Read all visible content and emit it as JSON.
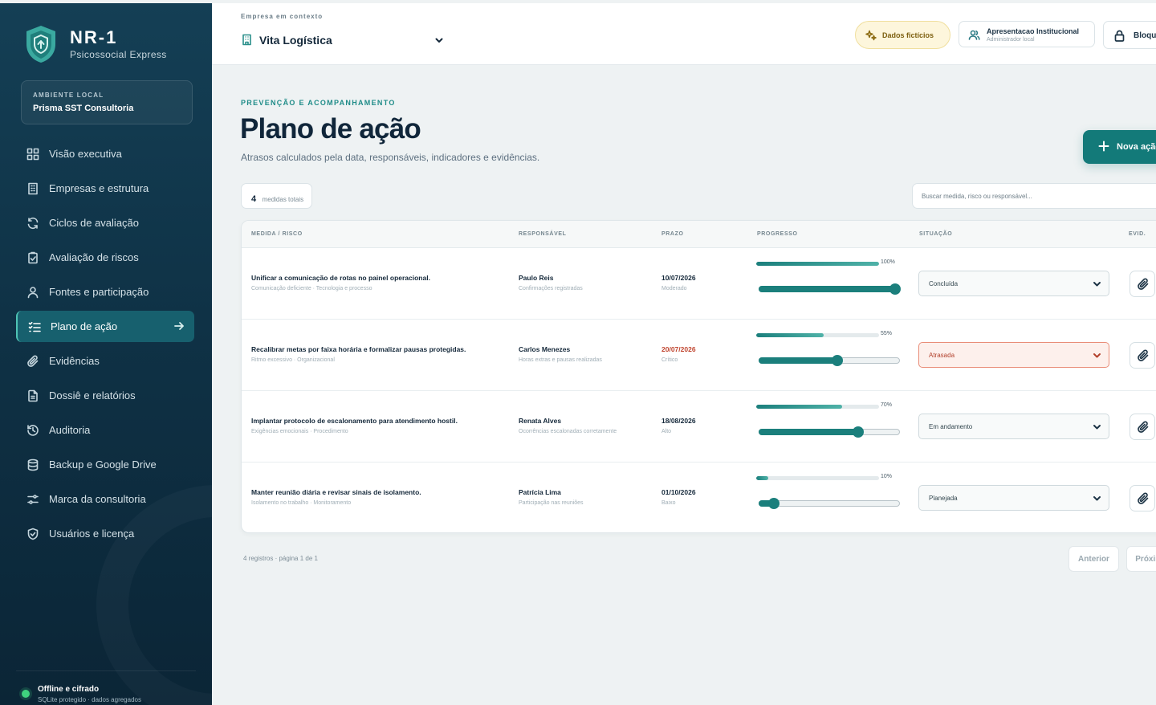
{
  "sidebar": {
    "brand_title": "NR-1",
    "brand_subtitle": "Psicossocial Express",
    "env_label": "AMBIENTE LOCAL",
    "env_name": "Prisma SST Consultoria",
    "items": [
      {
        "label": "Visão executiva",
        "icon": "grid-icon"
      },
      {
        "label": "Empresas e estrutura",
        "icon": "building-icon"
      },
      {
        "label": "Ciclos de avaliação",
        "icon": "refresh-icon"
      },
      {
        "label": "Avaliação de riscos",
        "icon": "clipboard-check-icon"
      },
      {
        "label": "Fontes e participação",
        "icon": "users-icon"
      },
      {
        "label": "Plano de ação",
        "icon": "list-checks-icon",
        "active": true
      },
      {
        "label": "Evidências",
        "icon": "paperclip-icon"
      },
      {
        "label": "Dossiê e relatórios",
        "icon": "file-icon"
      },
      {
        "label": "Auditoria",
        "icon": "history-icon"
      },
      {
        "label": "Backup e Google Drive",
        "icon": "database-icon"
      },
      {
        "label": "Marca da consultoria",
        "icon": "palette-icon"
      },
      {
        "label": "Usuários e licença",
        "icon": "shield-check-icon"
      }
    ],
    "status_title": "Offline e cifrado",
    "status_subtitle": "SQLite protegido · dados agregados",
    "status_color": "#3fd37e"
  },
  "topbar": {
    "context_label": "Empresa em contexto",
    "context_company": "Vita Logística",
    "demo_label": "Dados fictícios",
    "user_name": "Apresentacao Institucional",
    "user_role": "Administrador local",
    "lock_label": "Bloquear"
  },
  "header": {
    "eyebrow": "PREVENÇÃO E ACOMPANHAMENTO",
    "title": "Plano de ação",
    "subtitle": "Atrasos calculados pela data, responsáveis, indicadores e evidências.",
    "new_action_label": "Nova ação"
  },
  "toolbar": {
    "count": "4",
    "count_label": "medidas totais",
    "search_placeholder": "Buscar medida, risco ou responsável..."
  },
  "table": {
    "columns": [
      "MEDIDA / RISCO",
      "RESPONSÁVEL",
      "PRAZO",
      "PROGRESSO",
      "SITUAÇÃO",
      "EVID."
    ],
    "rows": [
      {
        "title": "Unificar a comunicação de rotas no painel operacional.",
        "meta": "Comunicação deficiente · Tecnologia e processo",
        "responsible": "Paulo Reis",
        "indicator": "Confirmações registradas",
        "due": "10/07/2026",
        "level": "Moderado",
        "late": false,
        "progress": 100,
        "progress_label": "100%",
        "status": "Concluída"
      },
      {
        "title": "Recalibrar metas por faixa horária e formalizar pausas protegidas.",
        "meta": "Ritmo excessivo · Organizacional",
        "responsible": "Carlos Menezes",
        "indicator": "Horas extras e pausas realizadas",
        "due": "20/07/2026",
        "level": "Crítico",
        "late": true,
        "progress": 55,
        "progress_label": "55%",
        "status": "Atrasada"
      },
      {
        "title": "Implantar protocolo de escalonamento para atendimento hostil.",
        "meta": "Exigências emocionais · Procedimento",
        "responsible": "Renata Alves",
        "indicator": "Ocorrências escalonadas corretamente",
        "due": "18/08/2026",
        "level": "Alto",
        "late": false,
        "progress": 70,
        "progress_label": "70%",
        "status": "Em andamento"
      },
      {
        "title": "Manter reunião diária e revisar sinais de isolamento.",
        "meta": "Isolamento no trabalho · Monitoramento",
        "responsible": "Patrícia Lima",
        "indicator": "Participação nas reuniões",
        "due": "01/10/2026",
        "level": "Baixo",
        "late": false,
        "progress": 10,
        "progress_label": "10%",
        "status": "Planejada"
      }
    ]
  },
  "pagination": {
    "info": "4 registros · página 1 de 1",
    "prev_label": "Anterior",
    "next_label": "Próxima"
  },
  "colors": {
    "accent": "#137a79",
    "late": "#c0452f",
    "sidebar": "#0f3246"
  }
}
